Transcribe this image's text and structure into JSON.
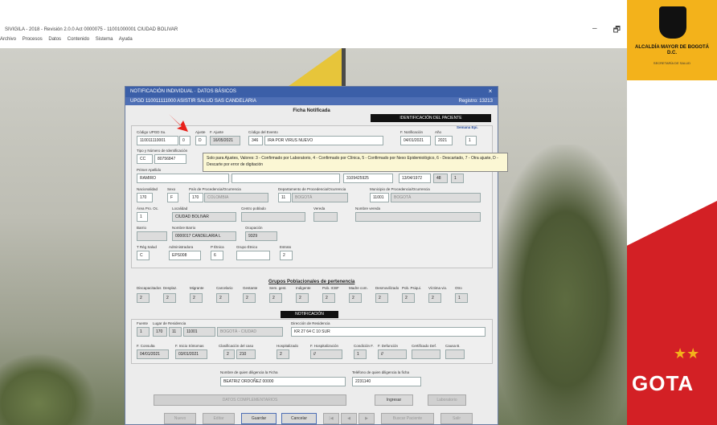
{
  "window": {
    "title": "SIVIGILA - 2018 - Revisión 2.0.0 Act 0000075 - 11001000001 CIUDAD BOLIVAR",
    "menu": [
      "Archivo",
      "Procesos",
      "Datos",
      "Contenido",
      "Sistema",
      "Ayuda"
    ],
    "controls": [
      "–",
      "🗗"
    ]
  },
  "branding": {
    "alcaldia": "ALCALDÍA MAYOR DE BOGOTÁ D.C.",
    "secretaria": "SECRETARÍA DE SALUD",
    "gota": "GOTA",
    "stars": "★★",
    "colors": {
      "yellow": "#f3b21b",
      "red": "#d32025"
    }
  },
  "dialog": {
    "title": "NOTIFICACIÓN INDIVIDUAL · DATOS BÁSICOS",
    "close": "×",
    "upgd": "UPGD 110011111000 ASISTIR SALUD SAS CANDELARIA",
    "registro": "Registro: 13213",
    "ficha": "Ficha Notificada",
    "id_pill": "IDENTIFICACIÓN DEL PACIENTE",
    "residencia_pill": "NOTIFICACIÓN",
    "fields": {
      "codigo_upgd": {
        "label": "Código UPGD Su.",
        "value": "110011110001"
      },
      "sub": {
        "label": "",
        "value": "0"
      },
      "ajuste": {
        "label": "Ajuste",
        "value": "D"
      },
      "f_ajuste": {
        "label": "F. Ajuste",
        "value": "16/05/2021"
      },
      "cod_evento": {
        "label": "Código del Evento",
        "value": "346"
      },
      "evento": {
        "label": "",
        "value": "IRA POR VIRUS NUEVO"
      },
      "f_notif": {
        "label": "F. Notificación",
        "value": "04/01/2021"
      },
      "anio": {
        "label": "Año",
        "value": "2021"
      },
      "semana": {
        "label": "Semana Epi.",
        "value": "1"
      },
      "tipo_id": {
        "label": "Tipo y Número de Identificación",
        "value": "CC"
      },
      "num_id": {
        "label": "",
        "value": "80756847"
      },
      "primer_apellido": {
        "label": "Primer Apellido",
        "value": "RAMIRO"
      },
      "segundo_apellido": {
        "label": "Segundo Apellido",
        "value": ""
      },
      "telefono": {
        "label": "Teléfono",
        "value": "3109425925"
      },
      "f_nac": {
        "label": "F. Nacimiento",
        "value": "13/04/1972"
      },
      "edad": {
        "label": "Edad",
        "value": "48"
      },
      "uni_med": {
        "label": "Und. Med.",
        "value": "1"
      },
      "nacionalidad": {
        "label": "Nacionalidad",
        "value": "170"
      },
      "sexo": {
        "label": "Sexo",
        "value": "F"
      },
      "pais": {
        "label": "País de Procedencia/Ocurrencia",
        "value": "170"
      },
      "pais_nombre": {
        "label": "",
        "value": "COLOMBIA"
      },
      "depto": {
        "label": "Departamento de Procedencia/Ocurrencia",
        "value": "11"
      },
      "depto_nombre": {
        "label": "",
        "value": "BOGOTÁ"
      },
      "municipio": {
        "label": "Municipio de Procedencia/Ocurrencia",
        "value": "11001"
      },
      "municipio_nombre": {
        "label": "",
        "value": "BOGOTÁ"
      },
      "area": {
        "label": "Área Pro. Oc.",
        "value": "1"
      },
      "localidad": {
        "label": "Localidad",
        "value": "CIUDAD BOLIVAR"
      },
      "centro_poblado": {
        "label": "Centro poblado",
        "value": ""
      },
      "vereda": {
        "label": "Vereda",
        "value": ""
      },
      "nombre_vereda": {
        "label": "Nombre vereda",
        "value": ""
      },
      "barrio": {
        "label": "Barrio",
        "value": ""
      },
      "nombre_barrio": {
        "label": "Nombre Barrio",
        "value": "0000017 CANDELARIA L"
      },
      "ocupacion": {
        "label": "Ocupación",
        "value": "9329"
      },
      "tipo_reg": {
        "label": "T Rég Salud",
        "value": "C"
      },
      "administradora": {
        "label": "Administradora",
        "value": "EPS008"
      },
      "pertenencia": {
        "label": "P Étnica",
        "value": "6"
      },
      "grupo_etnico": {
        "label": "Grupo Étnico",
        "value": ""
      },
      "estrato": {
        "label": "Estrato",
        "value": "2"
      }
    },
    "grupos_title": "Grupos Poblacionales de pertenencia",
    "grupos": [
      {
        "label": "Discapacitados",
        "value": "2"
      },
      {
        "label": "Desplaz.",
        "value": "2"
      },
      {
        "label": "Migrante",
        "value": "2"
      },
      {
        "label": "Carcelario",
        "value": "2"
      },
      {
        "label": "Gestante",
        "value": "2"
      },
      {
        "label": "Sem. gest.",
        "value": "2"
      },
      {
        "label": "Indigente",
        "value": "2"
      },
      {
        "label": "Pob. ICBF",
        "value": "2"
      },
      {
        "label": "Madre com.",
        "value": "2"
      },
      {
        "label": "Desmovilizado",
        "value": "2"
      },
      {
        "label": "Pob. Psiqui.",
        "value": "2"
      },
      {
        "label": "Víctima vio.",
        "value": "2"
      },
      {
        "label": "Otro",
        "value": "1"
      }
    ],
    "residencia": {
      "fuente": {
        "label": "Fuente",
        "value": "1"
      },
      "pais": {
        "label": "Lugar de Residencia",
        "value": "170"
      },
      "depto": {
        "label": "",
        "value": "11"
      },
      "mpio": {
        "label": "",
        "value": "11001"
      },
      "mpio_nombre": {
        "label": "",
        "value": "BOGOTÁ - CIUDAD"
      },
      "direccion": {
        "label": "Dirección de Residencia",
        "value": "KR 27 64 C 10 SUR"
      }
    },
    "consulta": {
      "f_consulta": {
        "label": "F. Consulta",
        "value": "04/01/2021"
      },
      "f_inicio": {
        "label": "F. Inicio Síntomas",
        "value": "03/01/2021"
      },
      "clasificacion": {
        "label": "Clasificación del caso",
        "value": "2"
      },
      "clasif_cod": {
        "label": "",
        "value": "210"
      },
      "hospitalizado": {
        "label": "Hospitalizado",
        "value": "2"
      },
      "f_hosp": {
        "label": "F. Hospitalización",
        "value": "//"
      },
      "condicion": {
        "label": "Condición F.",
        "value": "1"
      },
      "f_defuncion": {
        "label": "F. Defunción",
        "value": "//"
      },
      "cert_def": {
        "label": "Certificado Def.",
        "value": ""
      },
      "causa": {
        "label": "Causa B.",
        "value": ""
      }
    },
    "notificador": {
      "nombre": {
        "label": "Nombre de quien diligencia la Ficha",
        "value": "BEATRIZ ORDOÑEZ 00000"
      },
      "telefono": {
        "label": "Teléfono de quien diligencia la ficha",
        "value": "2231140"
      }
    },
    "tooltip": "Solo para Ajustes, Valores: 3 - Confirmado por Laboratorio, 4 - Confirmado por Clínica, 5 - Confirmado por Nexo Epidemiológico, 6 - Descartado, 7 - Otra ajuste, D - Descarte por error de digitación",
    "buttons": {
      "datos_complementarios": "DATOS COMPLEMENTARIOS",
      "ingresar": "Ingresar",
      "laboratorio": "Laboratorio",
      "nuevo": "Nuevo",
      "editar": "Editar",
      "guardar": "Guardar",
      "cancelar": "Cancelar",
      "first": "|◀",
      "prev": "◀",
      "next": "▶",
      "buscar_paciente": "Buscar Paciente",
      "salir": "Salir"
    }
  }
}
